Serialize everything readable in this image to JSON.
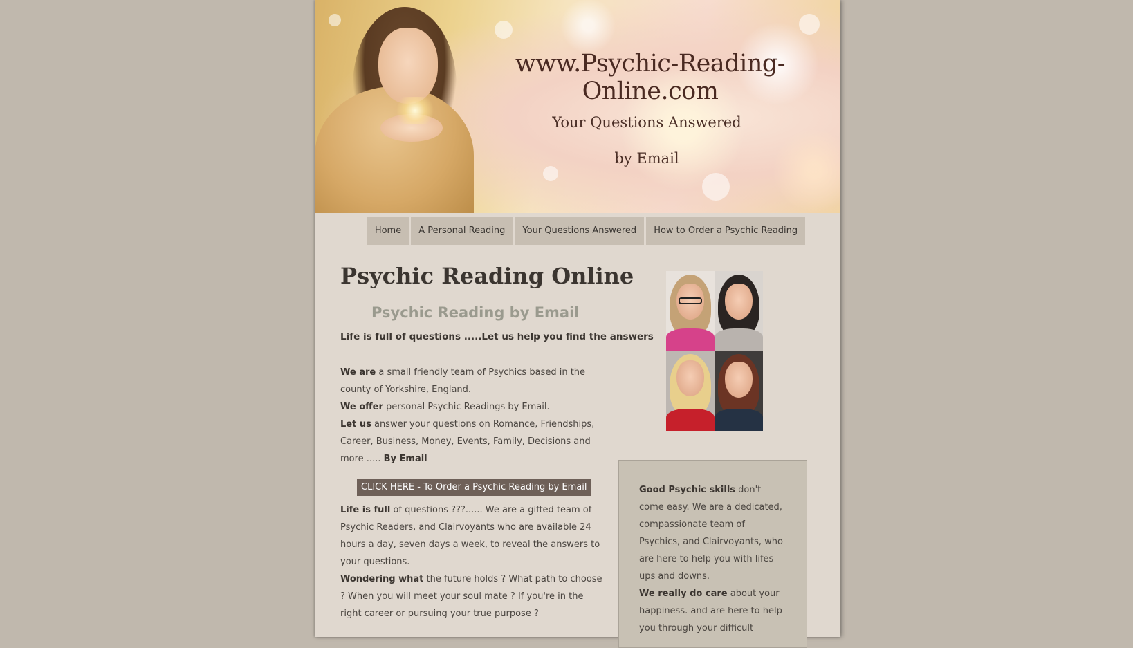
{
  "banner": {
    "site_url": "www.Psychic-Reading-Online.com",
    "tagline_line1": "Your Questions Answered",
    "tagline_line2": "by Email"
  },
  "nav": {
    "items": [
      {
        "label": "Home"
      },
      {
        "label": "A Personal Reading"
      },
      {
        "label": "Your Questions Answered"
      },
      {
        "label": "How to Order a Psychic Reading"
      }
    ]
  },
  "main": {
    "title": "Psychic Reading Online",
    "subtitle": "Psychic Reading by Email",
    "lead": "Life is full of questions .....Let us help you find the answers",
    "team": {
      "we_are_bold": "We are",
      "we_are_text": " a small friendly team of Psychics based in the county of Yorkshire, England.",
      "we_offer_bold": "We offer",
      "we_offer_text": " personal Psychic Readings by Email.",
      "let_us_bold": "Let us",
      "let_us_text": " answer your questions on Romance, Friendships, Career, Business, Money, Events, Family, Decisions and more ..... ",
      "by_email_bold": "By Email"
    },
    "cta_label": "CLICK HERE - To Order a Psychic Reading by Email",
    "life_full": {
      "bold": "Life is full",
      "text": " of questions ???...... We are a gifted team of Psychic Readers, and Clairvoyants who are available 24 hours a day, seven days a week, to reveal the answers to your questions."
    },
    "wondering": {
      "bold": "Wondering what",
      "text": " the future holds ? What path to choose ? When you will meet your soul mate ? If you're in the right career or pursuing your true purpose ?"
    }
  },
  "side": {
    "skills_bold": "Good Psychic skills",
    "skills_text": " don't come easy. We are a dedicated, compassionate team of Psychics, and Clairvoyants, who are here to help you with lifes ups and downs.",
    "care_bold": "We really do care",
    "care_text": " about your happiness. and are here to help you through your difficult"
  },
  "colors": {
    "page_background": "#c0b8ad",
    "content_background": "#e0d8cf",
    "nav_item_background": "#c7beb2",
    "cta_background": "#6e6058",
    "subtitle_color": "#9a9a8e",
    "side_box_background": "#c8c1b4"
  }
}
